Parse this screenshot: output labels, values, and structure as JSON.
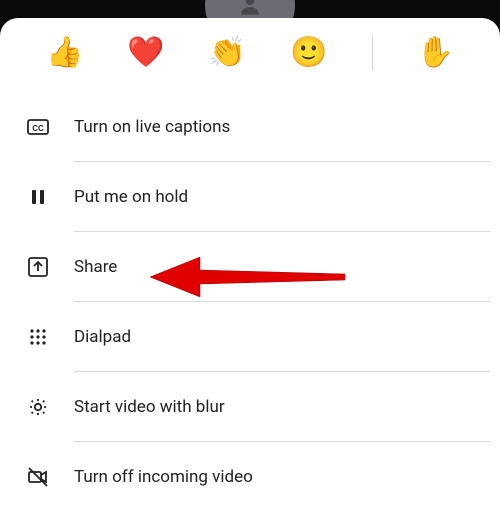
{
  "reactions": [
    {
      "name": "thumbs-up",
      "glyph": "👍"
    },
    {
      "name": "heart",
      "glyph": "❤️"
    },
    {
      "name": "applause",
      "glyph": "👏"
    },
    {
      "name": "smile",
      "glyph": "🙂"
    },
    {
      "name": "raise-hand",
      "glyph": "✋"
    }
  ],
  "menu": {
    "captions": {
      "label": "Turn on live captions"
    },
    "hold": {
      "label": "Put me on hold"
    },
    "share": {
      "label": "Share"
    },
    "dialpad": {
      "label": "Dialpad"
    },
    "blur": {
      "label": "Start video with blur"
    },
    "incoming": {
      "label": "Turn off incoming video"
    }
  }
}
